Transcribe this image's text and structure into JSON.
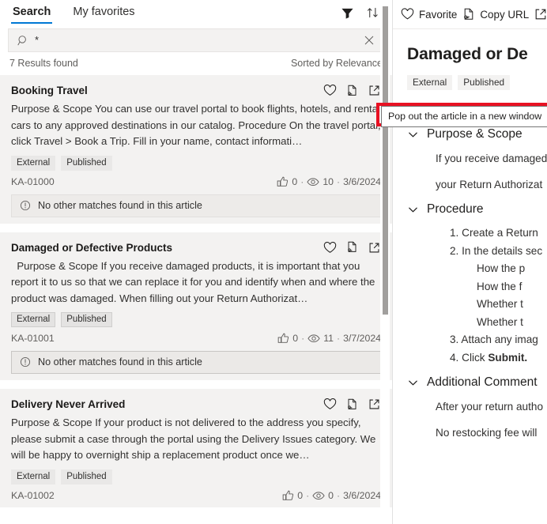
{
  "left": {
    "tabs": [
      {
        "label": "Search",
        "active": true
      },
      {
        "label": "My favorites",
        "active": false
      }
    ],
    "toolbar": {
      "filter_icon": "filter-icon",
      "sort_icon": "sort-icon"
    },
    "search": {
      "value": "*",
      "placeholder": "",
      "search_icon": "search-icon",
      "clear_icon": "close-icon"
    },
    "results_summary": "7 Results found",
    "sort_label": "Sorted by Relevance",
    "card_action_icons": [
      "heart-icon",
      "copy-url-icon",
      "pop-out-icon"
    ],
    "nomatch_label": "No other matches found in this article",
    "cards": [
      {
        "title": "Booking Travel",
        "snippet": "Purpose & Scope You can use our travel portal to book flights, hotels, and rental cars to any approved destinations in our catalog. Procedure On the travel portal, click Travel > Book a Trip. Fill in your name, contact informati…",
        "tags": [
          "External",
          "Published"
        ],
        "ka": "KA-01000",
        "likes": "0",
        "views": "10",
        "date": "3/6/2024",
        "selected": false,
        "show_nomatch": true
      },
      {
        "title": "Damaged or Defective Products",
        "snippet": "  Purpose & Scope If you receive damaged products, it is important that you report it to us so that we can replace it for you and identify when and where the product was damaged. When filling out your Return Authorizat…",
        "tags": [
          "External",
          "Published"
        ],
        "ka": "KA-01001",
        "likes": "0",
        "views": "11",
        "date": "3/7/2024",
        "selected": true,
        "show_nomatch": true
      },
      {
        "title": "Delivery Never Arrived",
        "snippet": "Purpose & Scope If your product is not delivered to the address you specify, please submit a case through the portal using the Delivery Issues category. We will be happy to overnight ship a replacement product once we…",
        "tags": [
          "External",
          "Published"
        ],
        "ka": "KA-01002",
        "likes": "0",
        "views": "0",
        "date": "3/6/2024",
        "selected": false,
        "show_nomatch": false
      }
    ]
  },
  "right": {
    "toolbar": [
      {
        "label": "Favorite",
        "icon": "heart-icon"
      },
      {
        "label": "Copy URL",
        "icon": "copy-url-icon"
      }
    ],
    "title": "Damaged or De",
    "tags": [
      "External",
      "Published"
    ],
    "sections": [
      {
        "heading": "Purpose & Scope",
        "chevron": "chevron-down-icon",
        "paragraphs": [
          "If you receive damaged",
          "your Return Authorizat"
        ]
      },
      {
        "heading": "Procedure",
        "chevron": "chevron-down-icon",
        "items": [
          {
            "num": "1.",
            "text": "Create a Return ",
            "sub": false
          },
          {
            "num": "2.",
            "text": "In the details sec",
            "sub": false
          },
          {
            "num": "",
            "text": "How the p",
            "sub": true
          },
          {
            "num": "",
            "text": "How the f",
            "sub": true
          },
          {
            "num": "",
            "text": "Whether t",
            "sub": true
          },
          {
            "num": "",
            "text": "Whether t",
            "sub": true
          },
          {
            "num": "3.",
            "text": "Attach any imag",
            "sub": false
          },
          {
            "num": "4.",
            "text": "Click ",
            "bold": "Submit.",
            "sub": false
          }
        ]
      },
      {
        "heading": "Additional Comment",
        "chevron": "chevron-down-icon",
        "paragraphs": [
          "After your return autho",
          "No restocking fee will "
        ]
      }
    ]
  },
  "tooltip": {
    "text": "Pop out the article in a new window",
    "highlight_color": "#e81123"
  },
  "colors": {
    "accent": "#0078d4",
    "card_bg": "#f3f2f1",
    "text": "#201f1e",
    "muted": "#605e5c",
    "highlight": "#e81123"
  }
}
